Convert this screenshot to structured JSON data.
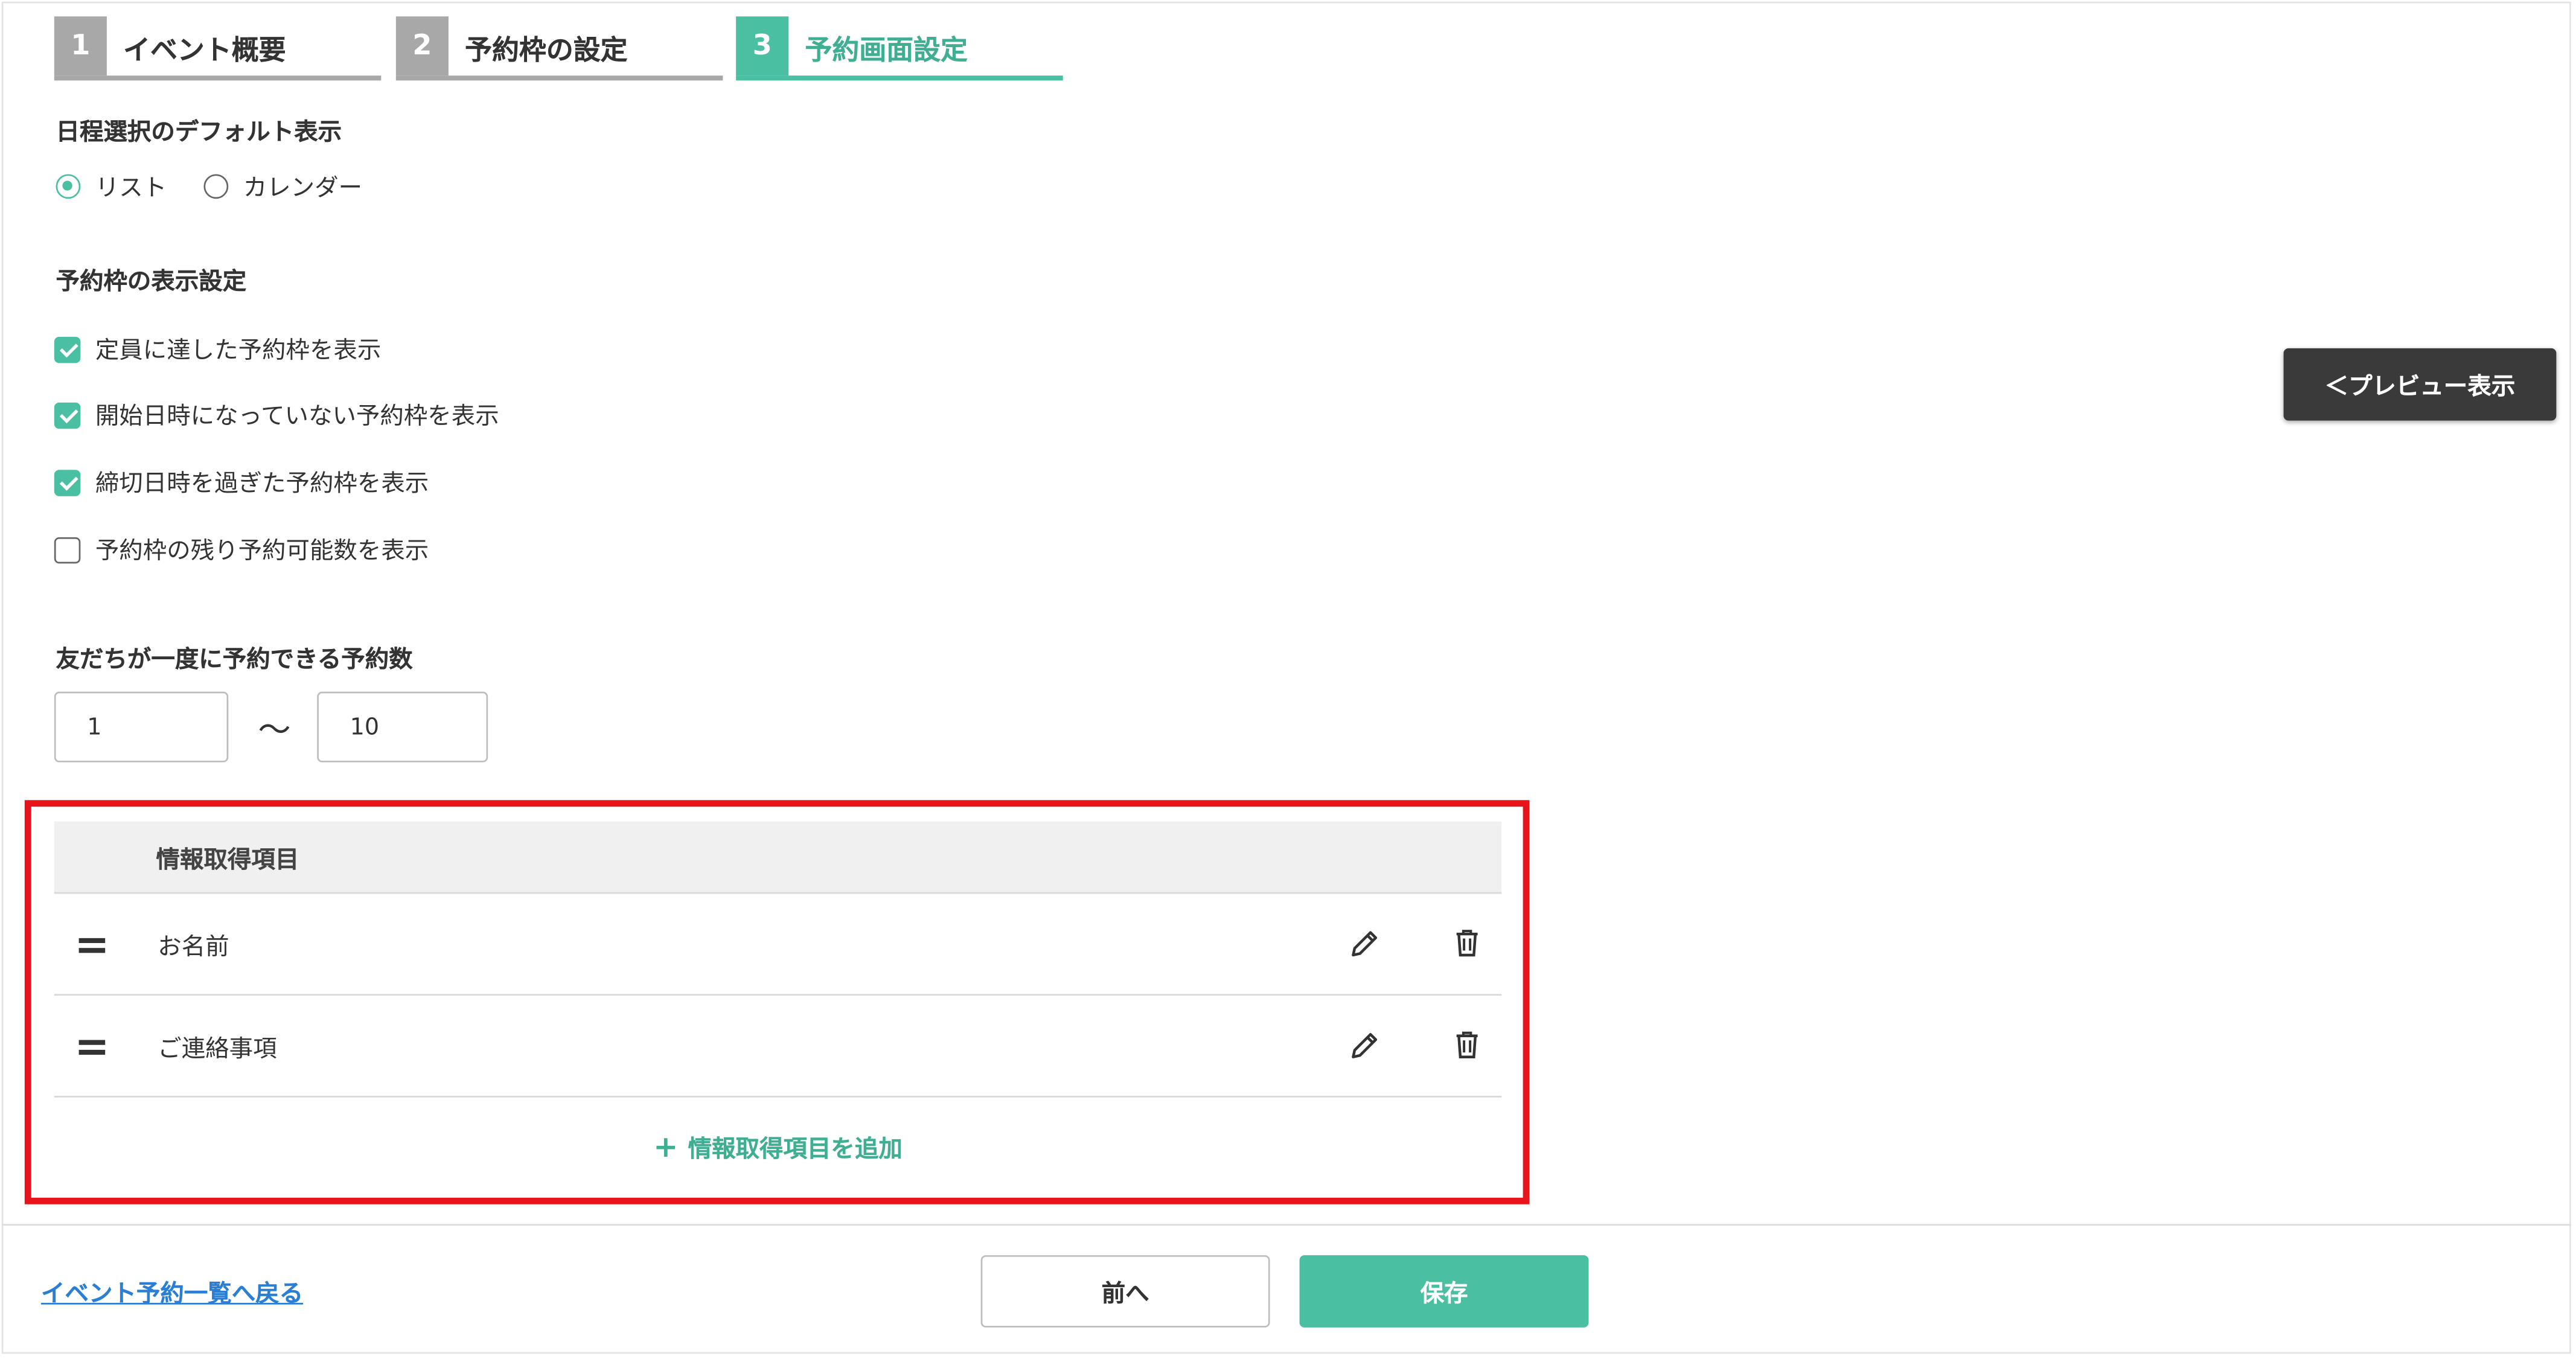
{
  "stepper": [
    {
      "number": "1",
      "label": "イベント概要",
      "state": "done"
    },
    {
      "number": "2",
      "label": "予約枠の設定",
      "state": "done"
    },
    {
      "number": "3",
      "label": "予約画面設定",
      "state": "active"
    }
  ],
  "date_display": {
    "heading": "日程選択のデフォルト表示",
    "options": [
      {
        "label": "リスト",
        "selected": true
      },
      {
        "label": "カレンダー",
        "selected": false
      }
    ]
  },
  "slot_display": {
    "heading": "予約枠の表示設定",
    "options": [
      {
        "label": "定員に達した予約枠を表示",
        "checked": true
      },
      {
        "label": "開始日時になっていない予約枠を表示",
        "checked": true
      },
      {
        "label": "締切日時を過ぎた予約枠を表示",
        "checked": true
      },
      {
        "label": "予約枠の残り予約可能数を表示",
        "checked": false
      }
    ]
  },
  "booking_count": {
    "heading": "友だちが一度に予約できる予約数",
    "min_value": "1",
    "separator": "〜",
    "max_value": "10"
  },
  "preview": {
    "label": "＜プレビュー表示"
  },
  "info_items": {
    "header": "情報取得項目",
    "rows": [
      {
        "label": "お名前"
      },
      {
        "label": "ご連絡事項"
      }
    ],
    "add_label": "情報取得項目を追加",
    "add_icon": "+"
  },
  "footer": {
    "back_link": "イベント予約一覧へ戻る",
    "prev_button": "前へ",
    "save_button": "保存"
  },
  "colors": {
    "accent": "#4abfa1",
    "inactive_step": "#a8a8a8",
    "highlight": "#e8141b",
    "link": "#2a7fd4"
  }
}
